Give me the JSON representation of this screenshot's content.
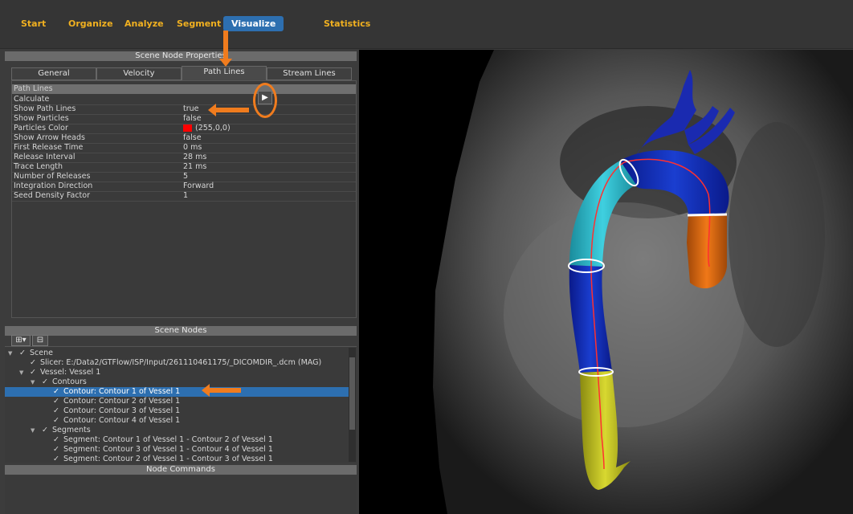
{
  "nav": {
    "items": [
      "Start",
      "Organize",
      "Analyze",
      "Segment",
      "Visualize",
      "Statistics"
    ],
    "active": "Visualize"
  },
  "scene_node_properties": {
    "title": "Scene Node Properties",
    "tabs": [
      "General",
      "Velocity",
      "Path Lines",
      "Stream Lines"
    ],
    "active_tab": "Path Lines",
    "group": "Path Lines",
    "properties": [
      {
        "key": "Calculate",
        "value": ""
      },
      {
        "key": "Show Path Lines",
        "value": "true"
      },
      {
        "key": "Show Particles",
        "value": "false"
      },
      {
        "key": "Particles Color",
        "value": "(255,0,0)"
      },
      {
        "key": "Show Arrow Heads",
        "value": "false"
      },
      {
        "key": "First Release Time",
        "value": "0 ms"
      },
      {
        "key": "Release Interval",
        "value": "28 ms"
      },
      {
        "key": "Trace Length",
        "value": "21 ms"
      },
      {
        "key": "Number of Releases",
        "value": "5"
      },
      {
        "key": "Integration Direction",
        "value": "Forward"
      },
      {
        "key": "Seed Density Factor",
        "value": "1"
      }
    ],
    "particles_color_hex": "#ff0000"
  },
  "scene_nodes": {
    "title": "Scene Nodes",
    "items": [
      "Scene",
      "Slicer: E:/Data2/GTFlow/ISP/Input/261110461175/_DICOMDIR_.dcm (MAG)",
      "Vessel: Vessel 1",
      "Contours",
      "Contour: Contour 1 of Vessel 1",
      "Contour: Contour 2 of Vessel 1",
      "Contour: Contour 3 of Vessel 1",
      "Contour: Contour 4 of Vessel 1",
      "Segments",
      "Segment: Contour 1 of Vessel 1 - Contour 2 of Vessel 1",
      "Segment: Contour 3 of Vessel 1 - Contour 4 of Vessel 1",
      "Segment: Contour 2 of Vessel 1 - Contour 3 of Vessel 1"
    ],
    "selected": "Contour: Contour 1 of Vessel 1"
  },
  "node_commands": {
    "title": "Node Commands"
  },
  "colors": {
    "accent_orange": "#f07c1e",
    "nav_gold": "#f0b020",
    "selection_blue": "#2d6fb0"
  }
}
